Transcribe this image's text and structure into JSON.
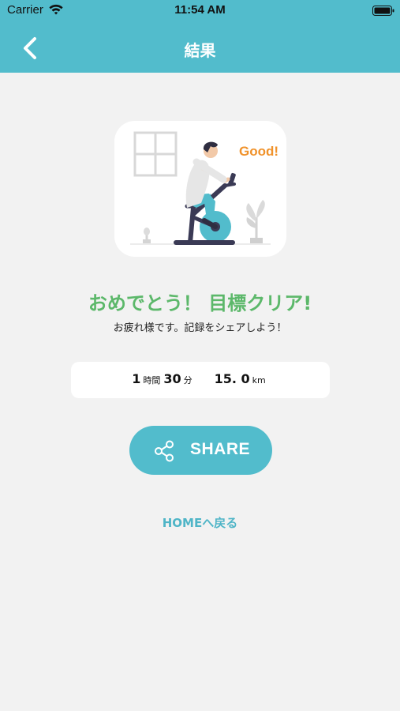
{
  "status_bar": {
    "carrier": "Carrier",
    "time": "11:54 AM",
    "wifi_icon": "wifi-icon",
    "battery_icon": "battery-icon"
  },
  "nav": {
    "title": "結果",
    "back_icon": "chevron-left-icon"
  },
  "illustration": {
    "badge_text": "Good!",
    "subject": "person-on-exercise-bike"
  },
  "result": {
    "headline": "おめでとう！ 目標クリア!",
    "message": "お疲れ様です。記録をシェアしよう！"
  },
  "stats": {
    "hours": "1",
    "hours_unit": "時間",
    "minutes": "30",
    "minutes_unit": "分",
    "distance": "15. 0",
    "distance_unit": "km"
  },
  "actions": {
    "share_label": "SHARE",
    "share_icon": "share-icon",
    "home_label": "HOMEへ戻る"
  },
  "colors": {
    "accent": "#52bccc",
    "headline_green": "#5cb86a",
    "background": "#f2f2f2",
    "badge_orange": "#f0922b"
  }
}
